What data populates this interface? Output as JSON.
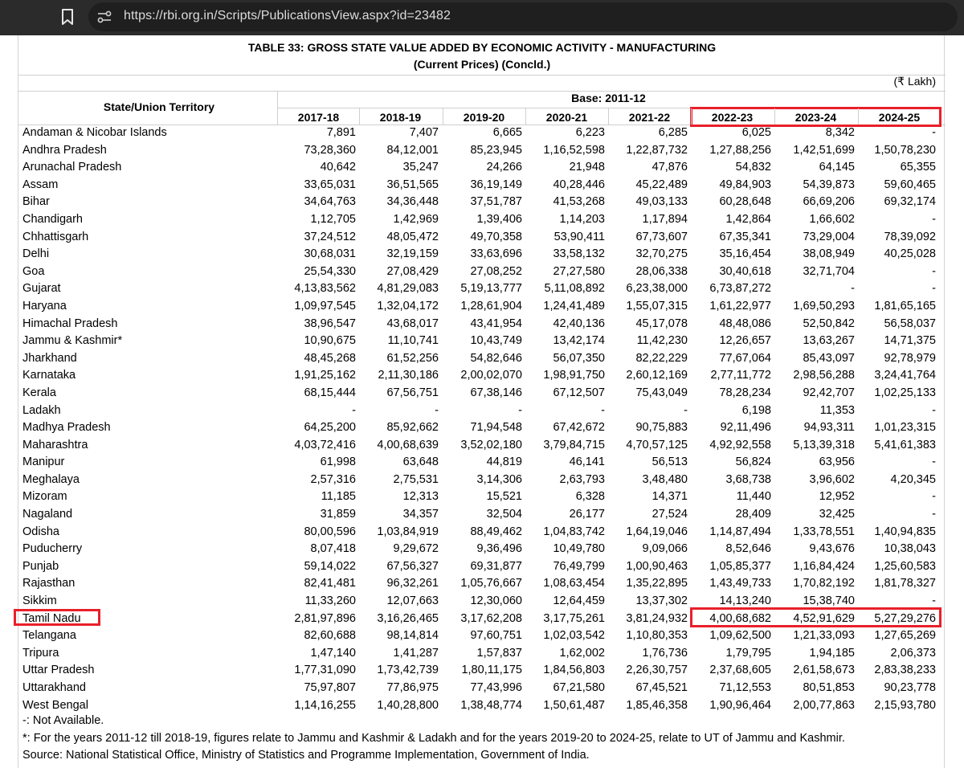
{
  "browser": {
    "url": "https://rbi.org.in/Scripts/PublicationsView.aspx?id=23482"
  },
  "table": {
    "title": "TABLE 33: GROSS STATE VALUE ADDED BY ECONOMIC ACTIVITY - MANUFACTURING",
    "subtitle": "(Current Prices) (Concld.)",
    "unit": "(₹ Lakh)",
    "state_header": "State/Union Territory",
    "base_label": "Base: 2011-12",
    "years": [
      "2017-18",
      "2018-19",
      "2019-20",
      "2020-21",
      "2021-22",
      "2022-23",
      "2023-24",
      "2024-25"
    ],
    "rows": [
      {
        "state": "Andaman & Nicobar Islands",
        "values": [
          "7,891",
          "7,407",
          "6,665",
          "6,223",
          "6,285",
          "6,025",
          "8,342",
          "-"
        ]
      },
      {
        "state": "Andhra Pradesh",
        "values": [
          "73,28,360",
          "84,12,001",
          "85,23,945",
          "1,16,52,598",
          "1,22,87,732",
          "1,27,88,256",
          "1,42,51,699",
          "1,50,78,230"
        ]
      },
      {
        "state": "Arunachal Pradesh",
        "values": [
          "40,642",
          "35,247",
          "24,266",
          "21,948",
          "47,876",
          "54,832",
          "64,145",
          "65,355"
        ]
      },
      {
        "state": "Assam",
        "values": [
          "33,65,031",
          "36,51,565",
          "36,19,149",
          "40,28,446",
          "45,22,489",
          "49,84,903",
          "54,39,873",
          "59,60,465"
        ]
      },
      {
        "state": "Bihar",
        "values": [
          "34,64,763",
          "34,36,448",
          "37,51,787",
          "41,53,268",
          "49,03,133",
          "60,28,648",
          "66,69,206",
          "69,32,174"
        ]
      },
      {
        "state": "Chandigarh",
        "values": [
          "1,12,705",
          "1,42,969",
          "1,39,406",
          "1,14,203",
          "1,17,894",
          "1,42,864",
          "1,66,602",
          "-"
        ]
      },
      {
        "state": "Chhattisgarh",
        "values": [
          "37,24,512",
          "48,05,472",
          "49,70,358",
          "53,90,411",
          "67,73,607",
          "67,35,341",
          "73,29,004",
          "78,39,092"
        ]
      },
      {
        "state": "Delhi",
        "values": [
          "30,68,031",
          "32,19,159",
          "33,63,696",
          "33,58,132",
          "32,70,275",
          "35,16,454",
          "38,08,949",
          "40,25,028"
        ]
      },
      {
        "state": "Goa",
        "values": [
          "25,54,330",
          "27,08,429",
          "27,08,252",
          "27,27,580",
          "28,06,338",
          "30,40,618",
          "32,71,704",
          "-"
        ]
      },
      {
        "state": "Gujarat",
        "values": [
          "4,13,83,562",
          "4,81,29,083",
          "5,19,13,777",
          "5,11,08,892",
          "6,23,38,000",
          "6,73,87,272",
          "-",
          "-"
        ]
      },
      {
        "state": "Haryana",
        "values": [
          "1,09,97,545",
          "1,32,04,172",
          "1,28,61,904",
          "1,24,41,489",
          "1,55,07,315",
          "1,61,22,977",
          "1,69,50,293",
          "1,81,65,165"
        ]
      },
      {
        "state": "Himachal Pradesh",
        "values": [
          "38,96,547",
          "43,68,017",
          "43,41,954",
          "42,40,136",
          "45,17,078",
          "48,48,086",
          "52,50,842",
          "56,58,037"
        ]
      },
      {
        "state": "Jammu & Kashmir*",
        "values": [
          "10,90,675",
          "11,10,741",
          "10,43,749",
          "13,42,174",
          "11,42,230",
          "12,26,657",
          "13,63,267",
          "14,71,375"
        ]
      },
      {
        "state": "Jharkhand",
        "values": [
          "48,45,268",
          "61,52,256",
          "54,82,646",
          "56,07,350",
          "82,22,229",
          "77,67,064",
          "85,43,097",
          "92,78,979"
        ]
      },
      {
        "state": "Karnataka",
        "values": [
          "1,91,25,162",
          "2,11,30,186",
          "2,00,02,070",
          "1,98,91,750",
          "2,60,12,169",
          "2,77,11,772",
          "2,98,56,288",
          "3,24,41,764"
        ]
      },
      {
        "state": "Kerala",
        "values": [
          "68,15,444",
          "67,56,751",
          "67,38,146",
          "67,12,507",
          "75,43,049",
          "78,28,234",
          "92,42,707",
          "1,02,25,133"
        ]
      },
      {
        "state": "Ladakh",
        "values": [
          "-",
          "-",
          "-",
          "-",
          "-",
          "6,198",
          "11,353",
          "-"
        ]
      },
      {
        "state": "Madhya Pradesh",
        "values": [
          "64,25,200",
          "85,92,662",
          "71,94,548",
          "67,42,672",
          "90,75,883",
          "92,11,496",
          "94,93,311",
          "1,01,23,315"
        ]
      },
      {
        "state": "Maharashtra",
        "values": [
          "4,03,72,416",
          "4,00,68,639",
          "3,52,02,180",
          "3,79,84,715",
          "4,70,57,125",
          "4,92,92,558",
          "5,13,39,318",
          "5,41,61,383"
        ]
      },
      {
        "state": "Manipur",
        "values": [
          "61,998",
          "63,648",
          "44,819",
          "46,141",
          "56,513",
          "56,824",
          "63,956",
          "-"
        ]
      },
      {
        "state": "Meghalaya",
        "values": [
          "2,57,316",
          "2,75,531",
          "3,14,306",
          "2,63,793",
          "3,48,480",
          "3,68,738",
          "3,96,602",
          "4,20,345"
        ]
      },
      {
        "state": "Mizoram",
        "values": [
          "11,185",
          "12,313",
          "15,521",
          "6,328",
          "14,371",
          "11,440",
          "12,952",
          "-"
        ]
      },
      {
        "state": "Nagaland",
        "values": [
          "31,859",
          "34,357",
          "32,504",
          "26,177",
          "27,524",
          "28,409",
          "32,425",
          "-"
        ]
      },
      {
        "state": "Odisha",
        "values": [
          "80,00,596",
          "1,03,84,919",
          "88,49,462",
          "1,04,83,742",
          "1,64,19,046",
          "1,14,87,494",
          "1,33,78,551",
          "1,40,94,835"
        ]
      },
      {
        "state": "Puducherry",
        "values": [
          "8,07,418",
          "9,29,672",
          "9,36,496",
          "10,49,780",
          "9,09,066",
          "8,52,646",
          "9,43,676",
          "10,38,043"
        ]
      },
      {
        "state": "Punjab",
        "values": [
          "59,14,022",
          "67,56,327",
          "69,31,877",
          "76,49,799",
          "1,00,90,463",
          "1,05,85,377",
          "1,16,84,424",
          "1,25,60,583"
        ]
      },
      {
        "state": "Rajasthan",
        "values": [
          "82,41,481",
          "96,32,261",
          "1,05,76,667",
          "1,08,63,454",
          "1,35,22,895",
          "1,43,49,733",
          "1,70,82,192",
          "1,81,78,327"
        ]
      },
      {
        "state": "Sikkim",
        "values": [
          "11,33,260",
          "12,07,663",
          "12,30,060",
          "12,64,459",
          "13,37,302",
          "14,13,240",
          "15,38,740",
          "-"
        ]
      },
      {
        "state": "Tamil Nadu",
        "values": [
          "2,81,97,896",
          "3,16,26,465",
          "3,17,62,208",
          "3,17,75,261",
          "3,81,24,932",
          "4,00,68,682",
          "4,52,91,629",
          "5,27,29,276"
        ]
      },
      {
        "state": "Telangana",
        "values": [
          "82,60,688",
          "98,14,814",
          "97,60,751",
          "1,02,03,542",
          "1,10,80,353",
          "1,09,62,500",
          "1,21,33,093",
          "1,27,65,269"
        ]
      },
      {
        "state": "Tripura",
        "values": [
          "1,47,140",
          "1,41,287",
          "1,57,837",
          "1,62,002",
          "1,76,736",
          "1,79,795",
          "1,94,185",
          "2,06,373"
        ]
      },
      {
        "state": "Uttar Pradesh",
        "values": [
          "1,77,31,090",
          "1,73,42,739",
          "1,80,11,175",
          "1,84,56,803",
          "2,26,30,757",
          "2,37,68,605",
          "2,61,58,673",
          "2,83,38,233"
        ]
      },
      {
        "state": "Uttarakhand",
        "values": [
          "75,97,807",
          "77,86,975",
          "77,43,996",
          "67,21,580",
          "67,45,521",
          "71,12,553",
          "80,51,853",
          "90,23,778"
        ]
      },
      {
        "state": "West Bengal",
        "values": [
          "1,14,16,255",
          "1,40,28,800",
          "1,38,48,774",
          "1,50,61,487",
          "1,85,46,358",
          "1,90,96,464",
          "2,00,77,863",
          "2,15,93,780"
        ]
      }
    ],
    "notes": [
      "-: Not Available.",
      "*: For the years 2011-12 till 2018-19, figures relate to Jammu and Kashmir & Ladakh and for the years 2019-20 to 2024-25, relate to UT of Jammu and Kashmir.",
      "Source: National Statistical Office, Ministry of Statistics and Programme Implementation, Government of India."
    ]
  },
  "highlight": {
    "color": "#e8202a",
    "columns": [
      "2022-23",
      "2023-24",
      "2024-25"
    ],
    "row": "Tamil Nadu"
  }
}
